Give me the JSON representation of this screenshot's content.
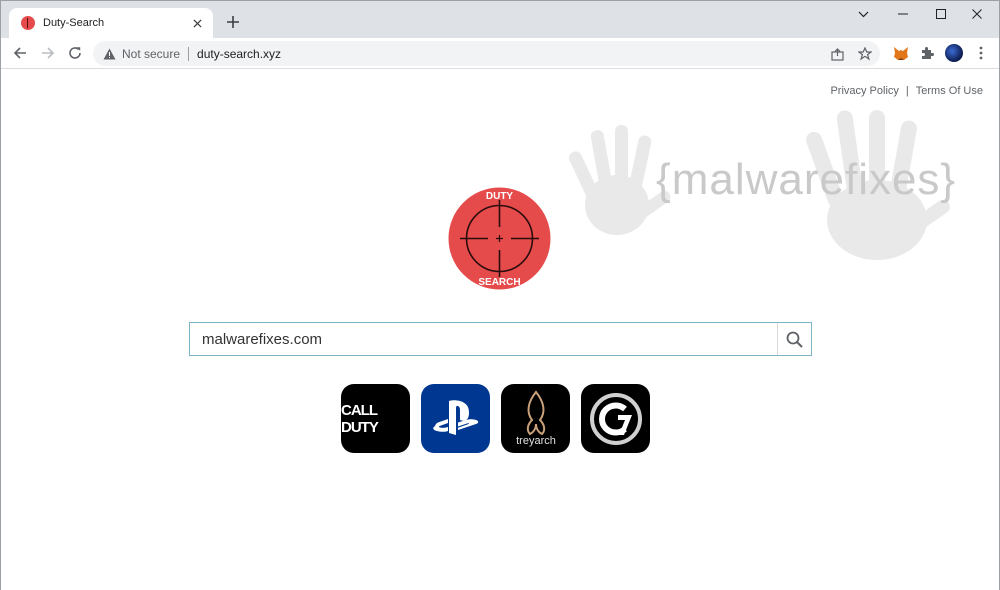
{
  "browser": {
    "tab_title": "Duty-Search",
    "address": {
      "security_label": "Not secure",
      "url": "duty-search.xyz"
    }
  },
  "page": {
    "links": {
      "privacy": "Privacy Policy",
      "separator": "|",
      "terms": "Terms Of Use"
    },
    "watermark_text": "{malwarefixes}",
    "logo": {
      "top_text": "DUTY",
      "bottom_text": "SEARCH",
      "color": "#e54b4b"
    },
    "search": {
      "value": "malwarefixes.com"
    },
    "shortcuts": [
      {
        "label": "CALL DUTY",
        "icon": "call-of-duty-icon"
      },
      {
        "label": "",
        "icon": "playstation-icon"
      },
      {
        "label": "treyarch",
        "icon": "treyarch-icon"
      },
      {
        "label": "",
        "icon": "c7-icon"
      }
    ]
  }
}
